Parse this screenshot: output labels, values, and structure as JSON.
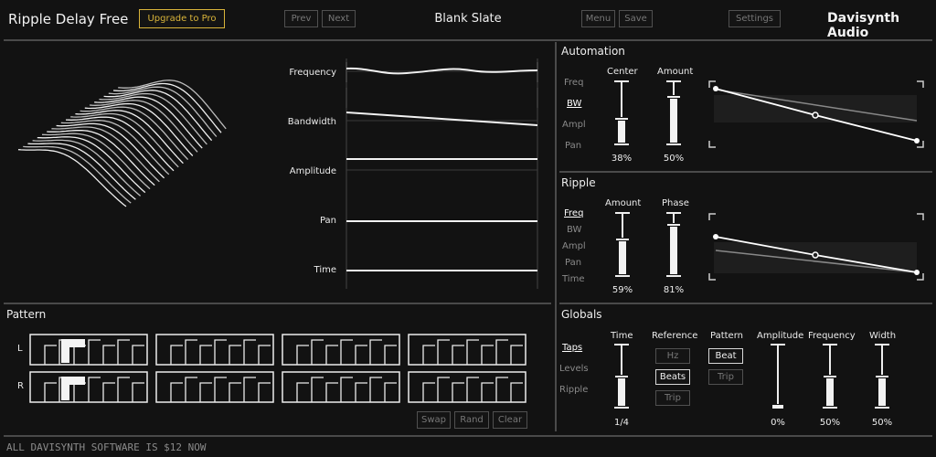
{
  "header": {
    "app_title": "Ripple Delay Free",
    "upgrade_label": "Upgrade to Pro",
    "prev_label": "Prev",
    "next_label": "Next",
    "preset_name": "Blank Slate",
    "menu_label": "Menu",
    "save_label": "Save",
    "settings_label": "Settings",
    "brand": "Davisynth Audio",
    "accent_color": "#d9b43a"
  },
  "graph": {
    "labels": [
      "Frequency",
      "Bandwidth",
      "Amplitude",
      "Pan",
      "Time"
    ]
  },
  "automation": {
    "title": "Automation",
    "params": [
      "Freq",
      "BW",
      "Ampl",
      "Pan"
    ],
    "selected": "BW",
    "center_label": "Center",
    "amount_label": "Amount",
    "center_value": "38%",
    "amount_value": "50%"
  },
  "ripple": {
    "title": "Ripple",
    "params": [
      "Freq",
      "BW",
      "Ampl",
      "Pan",
      "Time"
    ],
    "selected": "Freq",
    "amount_label": "Amount",
    "phase_label": "Phase",
    "amount_value": "59%",
    "phase_value": "81%"
  },
  "pattern": {
    "title": "Pattern",
    "row_labels": [
      "L",
      "R"
    ],
    "swap_label": "Swap",
    "rand_label": "Rand",
    "clear_label": "Clear"
  },
  "globals": {
    "title": "Globals",
    "modes": [
      "Taps",
      "Levels",
      "Ripple"
    ],
    "selected_mode": "Taps",
    "time_label": "Time",
    "time_value": "1/4",
    "reference_label": "Reference",
    "reference_options": [
      "Hz",
      "Beats",
      "Trip"
    ],
    "reference_selected": "Beats",
    "pattern_label": "Pattern",
    "pattern_options": [
      "Beat",
      "Trip"
    ],
    "pattern_selected": "Beat",
    "amplitude_label": "Amplitude",
    "amplitude_value": "0%",
    "frequency_label": "Frequency",
    "frequency_value": "50%",
    "width_label": "Width",
    "width_value": "50%"
  },
  "footer": {
    "text": "ALL DAVISYNTH SOFTWARE IS $12 NOW"
  }
}
